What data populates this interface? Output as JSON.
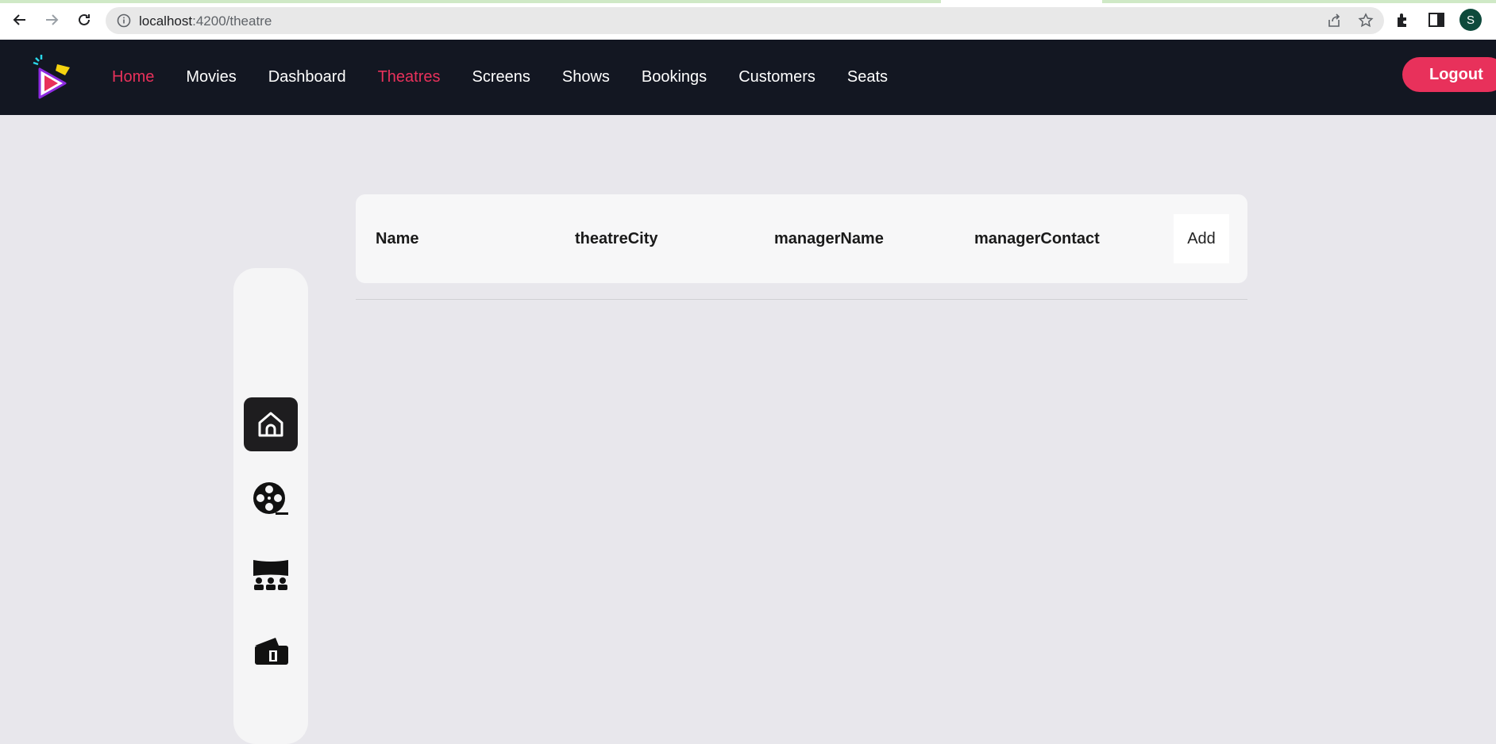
{
  "browser": {
    "url_host": "localhost",
    "url_path": ":4200/theatre",
    "profile_initial": "S"
  },
  "nav": {
    "links": [
      {
        "label": "Home",
        "active": true
      },
      {
        "label": "Movies",
        "active": false
      },
      {
        "label": "Dashboard",
        "active": false
      },
      {
        "label": "Theatres",
        "active": true
      },
      {
        "label": "Screens",
        "active": false
      },
      {
        "label": "Shows",
        "active": false
      },
      {
        "label": "Bookings",
        "active": false
      },
      {
        "label": "Customers",
        "active": false
      },
      {
        "label": "Seats",
        "active": false
      }
    ],
    "logout_label": "Logout"
  },
  "sidebar": {
    "items": [
      {
        "icon": "home-icon",
        "active": true
      },
      {
        "icon": "film-reel-icon",
        "active": false
      },
      {
        "icon": "theatre-screen-icon",
        "active": false
      },
      {
        "icon": "tickets-icon",
        "active": false
      }
    ]
  },
  "table": {
    "headers": [
      "Name",
      "theatreCity",
      "managerName",
      "managerContact"
    ],
    "add_label": "Add",
    "rows": []
  },
  "colors": {
    "accent": "#e8315b",
    "nav_bg": "#131722",
    "page_bg": "#e8e7ec"
  }
}
